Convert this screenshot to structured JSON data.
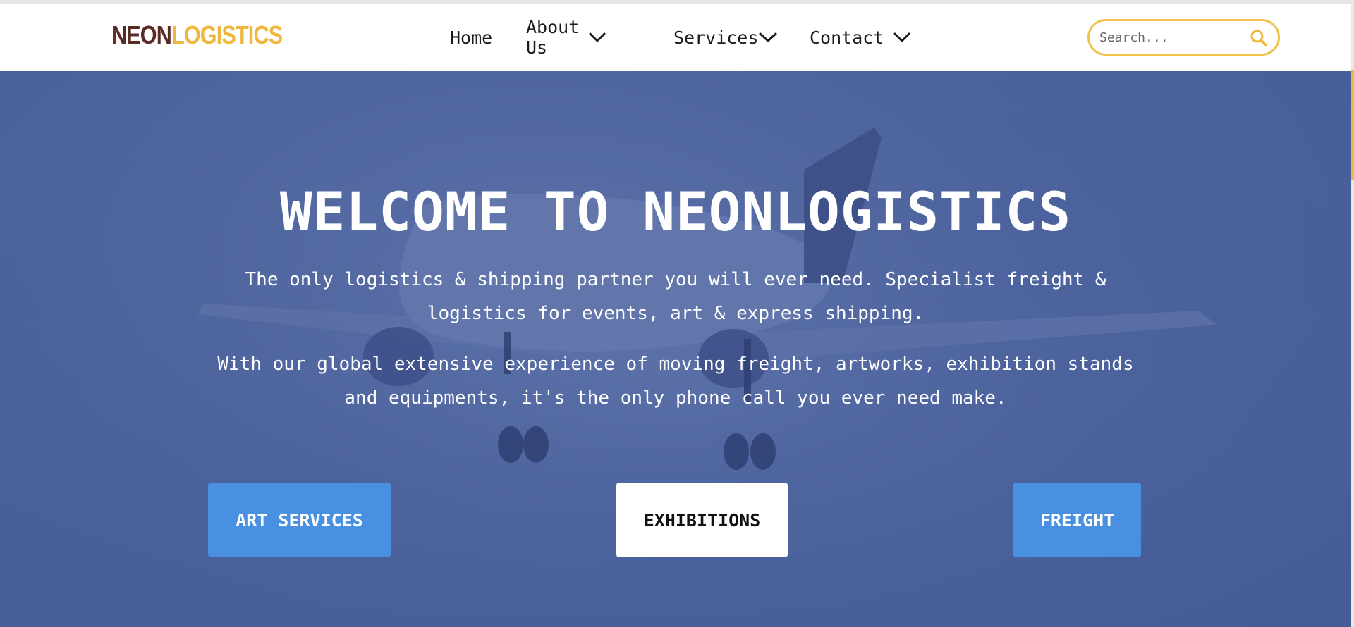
{
  "brand": {
    "part1": "NEON",
    "part2": "LOGISTICS"
  },
  "nav": {
    "items": [
      {
        "label": "Home"
      },
      {
        "label": "About Us"
      },
      {
        "label": "Services"
      },
      {
        "label": "Contact"
      }
    ]
  },
  "search": {
    "placeholder": "Search..."
  },
  "hero": {
    "title": "WELCOME TO NEONLOGISTICS",
    "paragraph1": "The only logistics & shipping partner you will ever need. Specialist freight & logistics for events, art & express shipping.",
    "paragraph2": "With our global extensive experience of moving freight, artworks, exhibition stands and equipments, it's the only phone call you ever need make."
  },
  "buttons": {
    "art": "ART SERVICES",
    "exhibitions": "EXHIBITIONS",
    "freight": "FREIGHT"
  },
  "colors": {
    "brand_dark": "#5a2a24",
    "brand_gold": "#f0b73e",
    "hero_blue": "#4c629d",
    "button_blue": "#4a90e2"
  }
}
